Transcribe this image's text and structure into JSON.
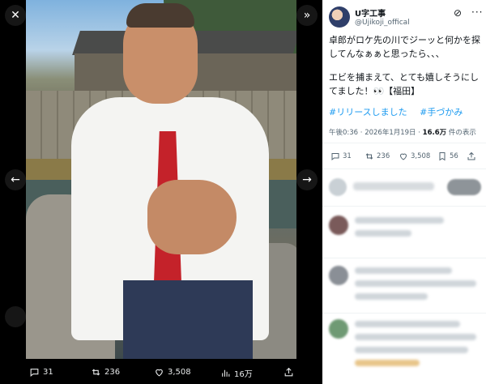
{
  "viewer": {
    "actions": {
      "replies": "31",
      "reposts": "236",
      "likes": "3,508",
      "views": "16万"
    }
  },
  "tweet": {
    "author_name": "U字工事",
    "author_handle": "@Ujikoji_offical",
    "text_lines": [
      "卓郎がロケ先の川でジーッと何かを探してんなぁぁと思ったら、、、",
      "エビを捕まえて、とても嬉しそうにしてました！👀【福田】"
    ],
    "hashtags": [
      "#リリースしました",
      "#手づかみ"
    ],
    "meta": {
      "time": "午後0:36 · 2026年1月19日 · ",
      "views_count": "16.6万",
      "views_label": " 件の表示"
    },
    "actions": {
      "replies": "31",
      "reposts": "236",
      "likes": "3,508",
      "bookmarks": "56"
    }
  },
  "colors": {
    "accent": "#1d9bf0",
    "tie": "#c4222a",
    "panel_bg": "#ffffff",
    "viewer_bg": "#000000"
  },
  "icons": {
    "close": "close-icon",
    "expand": "chevrons-right-icon",
    "prev": "arrow-left-icon",
    "next": "arrow-right-icon",
    "reply": "comment-icon",
    "repost": "repost-icon",
    "like": "heart-icon",
    "views": "bar-chart-icon",
    "share": "share-icon",
    "bookmark": "bookmark-icon",
    "grok": "grok-icon",
    "more": "more-icon"
  }
}
